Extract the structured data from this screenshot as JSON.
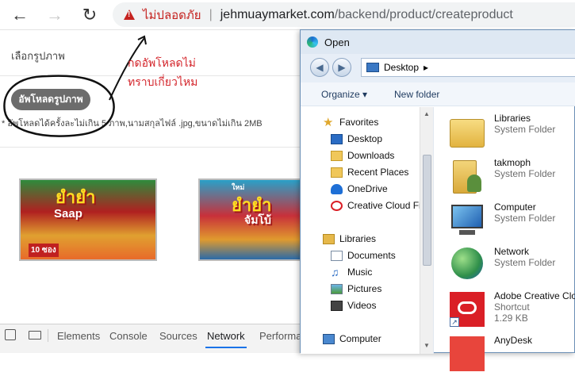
{
  "browser": {
    "back_icon": "back-arrow-icon",
    "forward_icon": "forward-arrow-icon",
    "reload_icon": "reload-icon",
    "security_label": "ไม่ปลอดภัย",
    "separator": "|",
    "url_host": "jehmuaymarket.com",
    "url_path": "/backend/product/createproduct"
  },
  "page": {
    "section_label": "เลือกรูปภาพ",
    "upload_button": "อัพโหลดรูปภาพ",
    "upload_note": "* อัพโหลดได้ครั้งละไม่เกิน 5 ภาพ,นามสกุลไฟล์ .jpg,ขนาดไม่เกิน 2MB",
    "annotation_line1": "กดอัพโหลดไม่",
    "annotation_line2": "ทราบเกี่ยวไหม",
    "annotation_color": "#d4262c",
    "product_images": [
      {
        "brand": "ยำยำ",
        "sub": "Saap",
        "badge": "10 ซอง"
      },
      {
        "brand": "ยำยำ",
        "sub": "จัมโบ้",
        "badge": "ใหม่"
      }
    ]
  },
  "devtools": {
    "tabs": [
      "Elements",
      "Console",
      "Sources",
      "Network",
      "Performar"
    ],
    "active_tab": "Network"
  },
  "dialog": {
    "title": "Open",
    "location": "Desktop",
    "organize": "Organize ▾",
    "new_folder": "New folder",
    "nav": [
      {
        "label": "Favorites",
        "icon": "star-icon",
        "level": 0
      },
      {
        "label": "Desktop",
        "icon": "desktop-icon",
        "level": 1
      },
      {
        "label": "Downloads",
        "icon": "downloads-icon",
        "level": 1
      },
      {
        "label": "Recent Places",
        "icon": "recent-places-icon",
        "level": 1
      },
      {
        "label": "OneDrive",
        "icon": "onedrive-icon",
        "level": 1
      },
      {
        "label": "Creative Cloud Fi",
        "icon": "creative-cloud-icon",
        "level": 1
      },
      {
        "label": "Libraries",
        "icon": "libraries-icon",
        "level": 0
      },
      {
        "label": "Documents",
        "icon": "documents-icon",
        "level": 1
      },
      {
        "label": "Music",
        "icon": "music-icon",
        "level": 1
      },
      {
        "label": "Pictures",
        "icon": "pictures-icon",
        "level": 1
      },
      {
        "label": "Videos",
        "icon": "videos-icon",
        "level": 1
      },
      {
        "label": "Computer",
        "icon": "computer-icon",
        "level": 0
      }
    ],
    "files": [
      {
        "name": "Libraries",
        "type": "System Folder",
        "icon": "libraries-folder-icon"
      },
      {
        "name": "takmoph",
        "type": "System Folder",
        "icon": "user-folder-icon"
      },
      {
        "name": "Computer",
        "type": "System Folder",
        "icon": "computer-icon"
      },
      {
        "name": "Network",
        "type": "System Folder",
        "icon": "network-icon"
      },
      {
        "name": "Adobe Creative Clou",
        "type": "Shortcut",
        "size": "1.29 KB",
        "icon": "adobe-cc-icon"
      },
      {
        "name": "AnyDesk",
        "type": "",
        "icon": "anydesk-icon"
      }
    ]
  }
}
